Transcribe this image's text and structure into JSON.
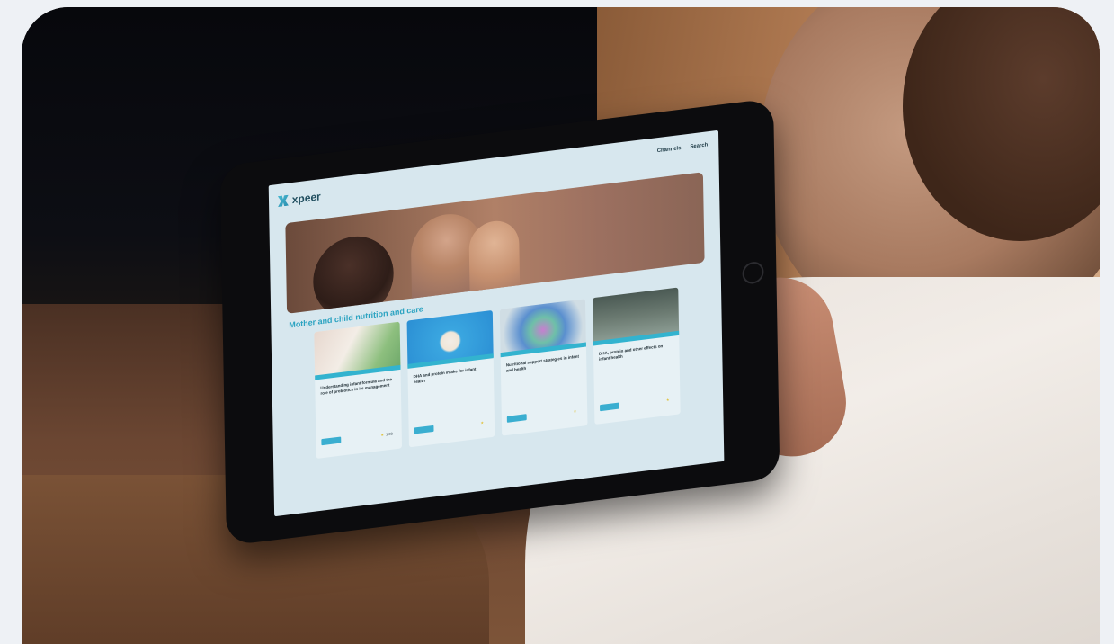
{
  "site": {
    "logo_text": "xpeer",
    "nav": [
      "Channels",
      "Search"
    ]
  },
  "section": {
    "title": "Mother and child nutrition and care"
  },
  "cards": [
    {
      "title": "Understanding infant formula and the role of probiotics in its management",
      "desc": "",
      "rating": "1.00"
    },
    {
      "title": "DHA and protein intake for infant health",
      "desc": "",
      "rating": ""
    },
    {
      "title": "Nutritional support strategies in infant and health",
      "desc": "",
      "rating": ""
    },
    {
      "title": "DHA, protein and other effects on infant health",
      "desc": "",
      "rating": ""
    }
  ],
  "colors": {
    "accent": "#33b3cf",
    "screen_bg": "#d7e7ee"
  }
}
